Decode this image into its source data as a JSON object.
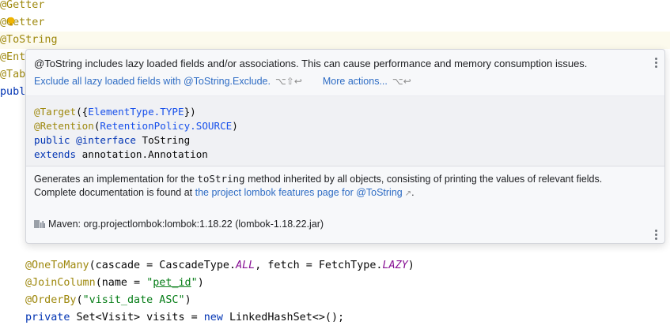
{
  "editor": {
    "line1": "@Getter",
    "line2_a": "@G",
    "line2_b": "etter",
    "line3": "@ToString",
    "line4": "@Ent",
    "line5": "@Tab",
    "line6": "publ",
    "line7": {
      "ann": "@OneToMany",
      "p1": "(cascade = CascadeType.",
      "c1": "ALL",
      "p2": ", fetch = FetchType.",
      "c2": "LAZY",
      "p3": ")"
    },
    "line8": {
      "ann": "@JoinColumn",
      "p1": "(name = ",
      "q1": "\"",
      "val": "pet_id",
      "q2": "\"",
      "p2": ")"
    },
    "line9": {
      "ann": "@OrderBy",
      "p1": "(",
      "str": "\"visit_date ASC\"",
      "p2": ")"
    },
    "line10": {
      "kw1": "private",
      "p1": " Set<Visit> visits = ",
      "kw2": "new",
      "p2": " LinkedHashSet<>();"
    }
  },
  "popup": {
    "message": "@ToString includes lazy loaded fields and/or associations. This can cause performance and memory consumption issues.",
    "action1": "Exclude all lazy loaded fields with @ToString.Exclude.",
    "action1_shortcut": "⌥⇧↩",
    "action2": "More actions...",
    "action2_shortcut": "⌥↩",
    "code": {
      "l1_ann": "@Target",
      "l1_p1": "({",
      "l1_ty": "ElementType.TYPE",
      "l1_p2": "})",
      "l2_ann": "@Retention",
      "l2_p1": "(",
      "l2_ty": "RetentionPolicy.SOURCE",
      "l2_p2": ")",
      "l3_kw": "public",
      "l3_ann": " @interface",
      "l3_p": " ToString",
      "l4_kw": "extends",
      "l4_p": " annotation.Annotation"
    },
    "doc": {
      "d1": "Generates an implementation for the ",
      "d1_code": "toString",
      "d2": " method inherited by all objects, consisting of printing the values of relevant fields.",
      "complete_prefix": "Complete documentation is found at ",
      "complete_link": "the project lombok features page for @ToString",
      "link_arrow": "↗",
      "complete_suffix": "."
    },
    "library": "Maven: org.projectlombok:lombok:1.18.22 (lombok-1.18.22.jar)"
  }
}
